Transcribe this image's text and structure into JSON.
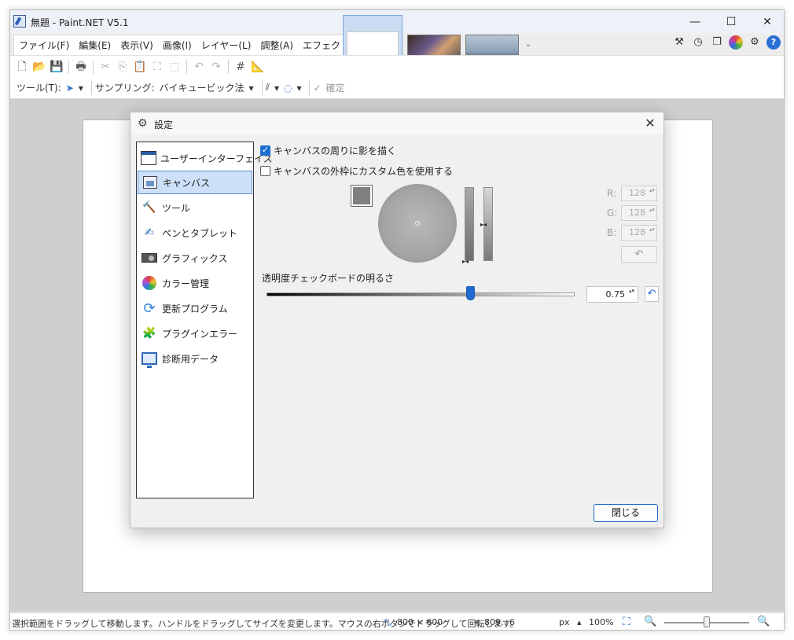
{
  "window": {
    "title": "無題 - Paint.NET V5.1",
    "min_glyph": "—",
    "max_glyph": "☐",
    "close_glyph": "✕"
  },
  "menu": [
    {
      "label": "ファイル(F)"
    },
    {
      "label": "編集(E)"
    },
    {
      "label": "表示(V)"
    },
    {
      "label": "画像(I)"
    },
    {
      "label": "レイヤー(L)"
    },
    {
      "label": "調整(A)"
    },
    {
      "label": "エフェクト(C)"
    }
  ],
  "right_tools": {
    "tools_glyph": "⚒",
    "history_glyph": "◷",
    "layers_glyph": "❐",
    "settings_glyph": "⚙",
    "help_glyph": "?"
  },
  "toolbar1": {
    "new": "🗋",
    "open": "📂",
    "save": "💾",
    "print": "🖶",
    "cut": "✂",
    "copy": "⎘",
    "paste": "📋",
    "crop": "⛶",
    "deselect": "⬚",
    "undo": "↶",
    "redo": "↷",
    "grid": "#",
    "ruler": "📐"
  },
  "toolbar2": {
    "tool_label": "ツール(T):",
    "tool_glyph": "➤",
    "dropdown_glyph": "▾",
    "sampling_label": "サンプリング:",
    "sampling_value": "バイキュービック法",
    "antialias_glyph": "⫽",
    "blend_glyph": "◌",
    "commit_glyph": "✓",
    "commit_label": "確定"
  },
  "statusbar": {
    "hint": "選択範囲をドラッグして移動します。ハンドルをドラッグしてサイズを変更します。マウスの右ボタンでドラッグして回転します。",
    "size_glyph": "⤡",
    "size": "800 × 600",
    "pos_glyph": "⌖",
    "position": "809, -6",
    "unit": "px",
    "unit_arrow": "▴",
    "zoom": "100%",
    "fit_glyph": "⛶",
    "zoom_out_glyph": "🔍",
    "zoom_in_glyph": "🔍"
  },
  "dialog": {
    "title": "設定",
    "gear_glyph": "⚙",
    "close_glyph": "✕",
    "nav": [
      {
        "label": "ユーザーインターフェイス",
        "icon": "window-icon"
      },
      {
        "label": "キャンバス",
        "icon": "canvas-icon"
      },
      {
        "label": "ツール",
        "icon": "hammer-icon",
        "glyph": "🔨"
      },
      {
        "label": "ペンとタブレット",
        "icon": "pen-tablet-icon",
        "glyph": "✍"
      },
      {
        "label": "グラフィックス",
        "icon": "gpu-icon"
      },
      {
        "label": "カラー管理",
        "icon": "color-wheel-icon"
      },
      {
        "label": "更新プログラム",
        "icon": "refresh-icon",
        "glyph": "⟳"
      },
      {
        "label": "プラグインエラー",
        "icon": "puzzle-icon",
        "glyph": "🧩"
      },
      {
        "label": "診断用データ",
        "icon": "monitor-icon"
      }
    ],
    "selected_nav": "キャンバス",
    "shadow_checkbox": {
      "label": "キャンバスの周りに影を描く",
      "checked": true
    },
    "custom_color_checkbox": {
      "label": "キャンバスの外枠にカスタム色を使用する",
      "checked": false
    },
    "color": {
      "swatch": "#808080",
      "r_label": "R:",
      "r": "128",
      "g_label": "G:",
      "g": "128",
      "b_label": "B:",
      "b": "128",
      "reset_glyph": "↶",
      "spin_glyph": "▴▾"
    },
    "slider_label": "透明度チェックボードの明るさ",
    "slider_value": "0.75",
    "slider_fraction": 0.66,
    "slider_reset_glyph": "↶",
    "close_button": "閉じる",
    "grip_glyph": "⋰"
  },
  "accent": "#1e6ad0"
}
